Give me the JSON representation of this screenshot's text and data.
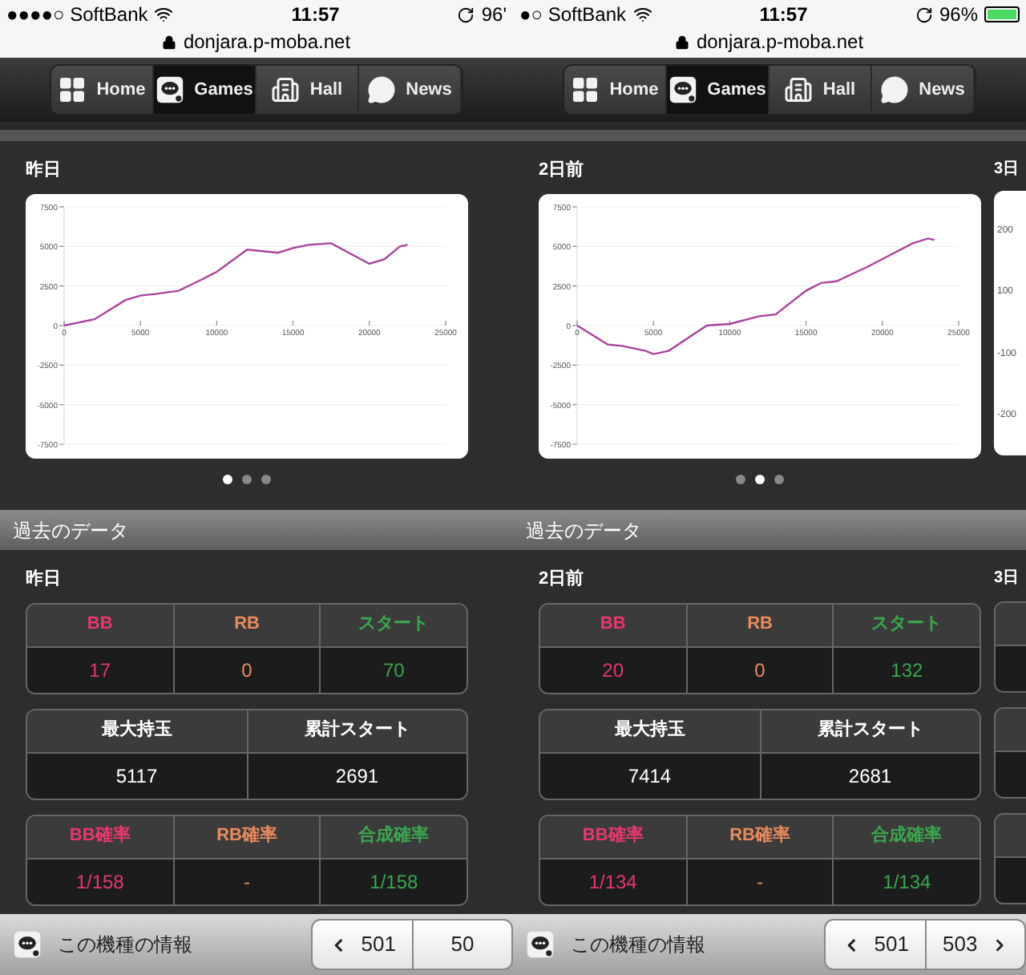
{
  "screens": [
    {
      "status_bar": {
        "carrier": "●●●●○ SoftBank",
        "time": "11:57",
        "url": "donjara.p-moba.net",
        "battery": "96'"
      },
      "nav_tabs": [
        {
          "label": "Home",
          "kind": "grid",
          "selected": false
        },
        {
          "label": "Games",
          "kind": "games",
          "selected": true
        },
        {
          "label": "Hall",
          "kind": "building",
          "selected": false
        },
        {
          "label": "News",
          "kind": "bubble",
          "selected": false
        }
      ],
      "chart_label": "昨日",
      "chart_data": {
        "type": "line",
        "x": [
          0,
          2000,
          4000,
          5000,
          6000,
          7500,
          9000,
          10000,
          12000,
          14000,
          15000,
          16000,
          17500,
          20000,
          21000,
          22000,
          22500
        ],
        "series": [
          {
            "color": "#a8449a",
            "values": [
              0,
              400,
              1600,
              1900,
              2000,
              2200,
              2900,
              3400,
              4800,
              4600,
              4900,
              5100,
              5200,
              3900,
              4200,
              5000,
              5100
            ]
          }
        ],
        "grid": true,
        "xlim": [
          0,
          25000
        ],
        "ylim": [
          -7500,
          7500
        ],
        "xticks": [
          0,
          5000,
          10000,
          15000,
          20000,
          25000
        ],
        "yticks": [
          -7500,
          -5000,
          -2500,
          0,
          2500,
          5000,
          7500
        ]
      },
      "dots": [
        {
          "selected": true
        },
        {
          "selected": false
        },
        {
          "selected": false
        }
      ],
      "section_title": "過去のデータ",
      "data_label": "昨日",
      "tables": [
        [
          {
            "label": "BB",
            "value": "17",
            "color": "#e8386e"
          },
          {
            "label": "RB",
            "value": "0",
            "color": "#e98a5c"
          },
          {
            "label": "スタート",
            "value": "70",
            "color": "#3aa64e"
          }
        ],
        [
          {
            "label": "最大持玉",
            "value": "5117",
            "color": "#ffffff"
          },
          {
            "label": "累計スタート",
            "value": "2691",
            "color": "#ffffff"
          }
        ],
        [
          {
            "label": "BB確率",
            "value": "1/158",
            "color": "#e8386e"
          },
          {
            "label": "RB確率",
            "value": "-",
            "color": "#e98a5c"
          },
          {
            "label": "合成確率",
            "value": "1/158",
            "color": "#3aa64e"
          }
        ]
      ],
      "info_label": "この機種の情報",
      "pager": [
        {
          "label": "501",
          "kind": "prev"
        },
        {
          "label": "50",
          "kind": "plain"
        }
      ]
    },
    {
      "status_bar": {
        "carrier": "●○ SoftBank",
        "time": "11:57",
        "url": "donjara.p-moba.net",
        "battery": "96%",
        "battery_icon": true
      },
      "nav_tabs": [
        {
          "label": "Home",
          "kind": "grid",
          "selected": false
        },
        {
          "label": "Games",
          "kind": "games",
          "selected": true
        },
        {
          "label": "Hall",
          "kind": "building",
          "selected": false
        },
        {
          "label": "News",
          "kind": "bubble",
          "selected": false
        }
      ],
      "chart_label": "2日前",
      "chart_data": {
        "type": "line",
        "x": [
          0,
          2000,
          3000,
          4500,
          5000,
          6000,
          8500,
          10000,
          12000,
          13000,
          15000,
          16000,
          17000,
          19000,
          21000,
          22000,
          23000,
          23400
        ],
        "series": [
          {
            "color": "#a8449a",
            "values": [
              0,
              -1200,
              -1300,
              -1600,
              -1800,
              -1600,
              0,
              100,
              600,
              700,
              2200,
              2700,
              2800,
              3700,
              4700,
              5200,
              5500,
              5400
            ]
          }
        ],
        "grid": true,
        "xlim": [
          0,
          25000
        ],
        "ylim": [
          -7500,
          7500
        ],
        "xticks": [
          0,
          5000,
          10000,
          15000,
          20000,
          25000
        ],
        "yticks": [
          -7500,
          -5000,
          -2500,
          0,
          2500,
          5000,
          7500
        ]
      },
      "dots": [
        {
          "selected": false
        },
        {
          "selected": true
        },
        {
          "selected": false
        }
      ],
      "next_chart": {
        "label": "3日",
        "ticks": [
          "200",
          "100",
          "-100",
          "-200"
        ]
      },
      "section_title": "過去のデータ",
      "data_label": "2日前",
      "next_data_label": "3日",
      "tables": [
        [
          {
            "label": "BB",
            "value": "20",
            "color": "#e8386e"
          },
          {
            "label": "RB",
            "value": "0",
            "color": "#e98a5c"
          },
          {
            "label": "スタート",
            "value": "132",
            "color": "#3aa64e"
          }
        ],
        [
          {
            "label": "最大持玉",
            "value": "7414",
            "color": "#ffffff"
          },
          {
            "label": "累計スタート",
            "value": "2681",
            "color": "#ffffff"
          }
        ],
        [
          {
            "label": "BB確率",
            "value": "1/134",
            "color": "#e8386e"
          },
          {
            "label": "RB確率",
            "value": "-",
            "color": "#e98a5c"
          },
          {
            "label": "合成確率",
            "value": "1/134",
            "color": "#3aa64e"
          }
        ]
      ],
      "info_label": "この機種の情報",
      "pager": [
        {
          "label": "501",
          "kind": "prev"
        },
        {
          "label": "503",
          "kind": "next"
        }
      ]
    }
  ]
}
